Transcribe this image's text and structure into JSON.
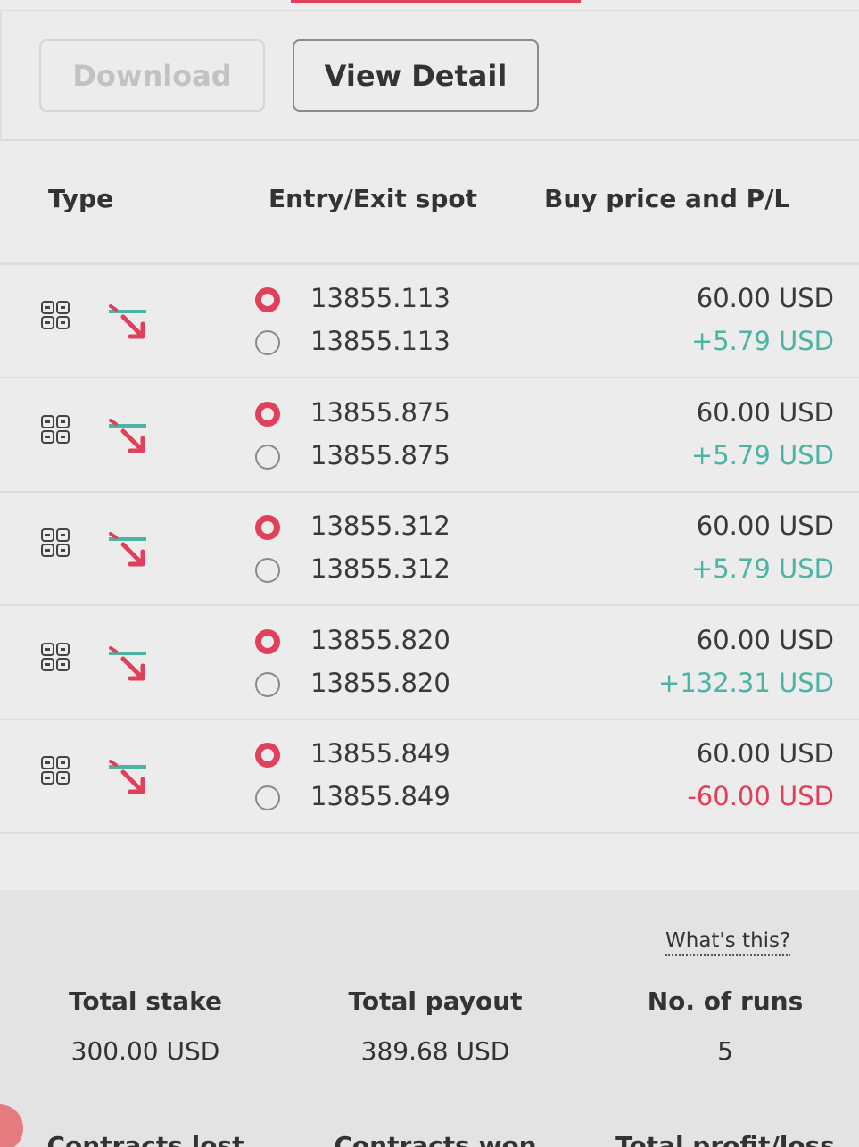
{
  "toolbar": {
    "download_label": "Download",
    "view_detail_label": "View Detail"
  },
  "table": {
    "headers": {
      "type": "Type",
      "entry_exit": "Entry/Exit spot",
      "buy_pl": "Buy price and P/L"
    },
    "rows": [
      {
        "type_icon": "grid-icon",
        "direction_icon": "arrow-down-right-icon",
        "entry": "13855.113",
        "exit": "13855.113",
        "buy": "60.00 USD",
        "pl": "+5.79 USD",
        "pl_sign": "positive"
      },
      {
        "type_icon": "grid-icon",
        "direction_icon": "arrow-down-right-icon",
        "entry": "13855.875",
        "exit": "13855.875",
        "buy": "60.00 USD",
        "pl": "+5.79 USD",
        "pl_sign": "positive"
      },
      {
        "type_icon": "grid-icon",
        "direction_icon": "arrow-down-right-icon",
        "entry": "13855.312",
        "exit": "13855.312",
        "buy": "60.00 USD",
        "pl": "+5.79 USD",
        "pl_sign": "positive"
      },
      {
        "type_icon": "grid-icon",
        "direction_icon": "arrow-down-right-icon",
        "entry": "13855.820",
        "exit": "13855.820",
        "buy": "60.00 USD",
        "pl": "+132.31 USD",
        "pl_sign": "positive"
      },
      {
        "type_icon": "grid-icon",
        "direction_icon": "arrow-down-right-icon",
        "entry": "13855.849",
        "exit": "13855.849",
        "buy": "60.00 USD",
        "pl": "-60.00 USD",
        "pl_sign": "negative"
      }
    ]
  },
  "summary": {
    "whats_this": "What's this?",
    "total_stake_label": "Total stake",
    "total_stake_value": "300.00 USD",
    "total_payout_label": "Total payout",
    "total_payout_value": "389.68 USD",
    "runs_label": "No. of runs",
    "runs_value": "5",
    "contracts_lost_label": "Contracts lost",
    "contracts_won_label": "Contracts won",
    "total_pl_label": "Total profit/loss"
  },
  "colors": {
    "accent": "#e0405a",
    "profit": "#4bb4a3",
    "loss": "#e0405a",
    "background": "#ececec",
    "summary_background": "#e3e3e5"
  }
}
